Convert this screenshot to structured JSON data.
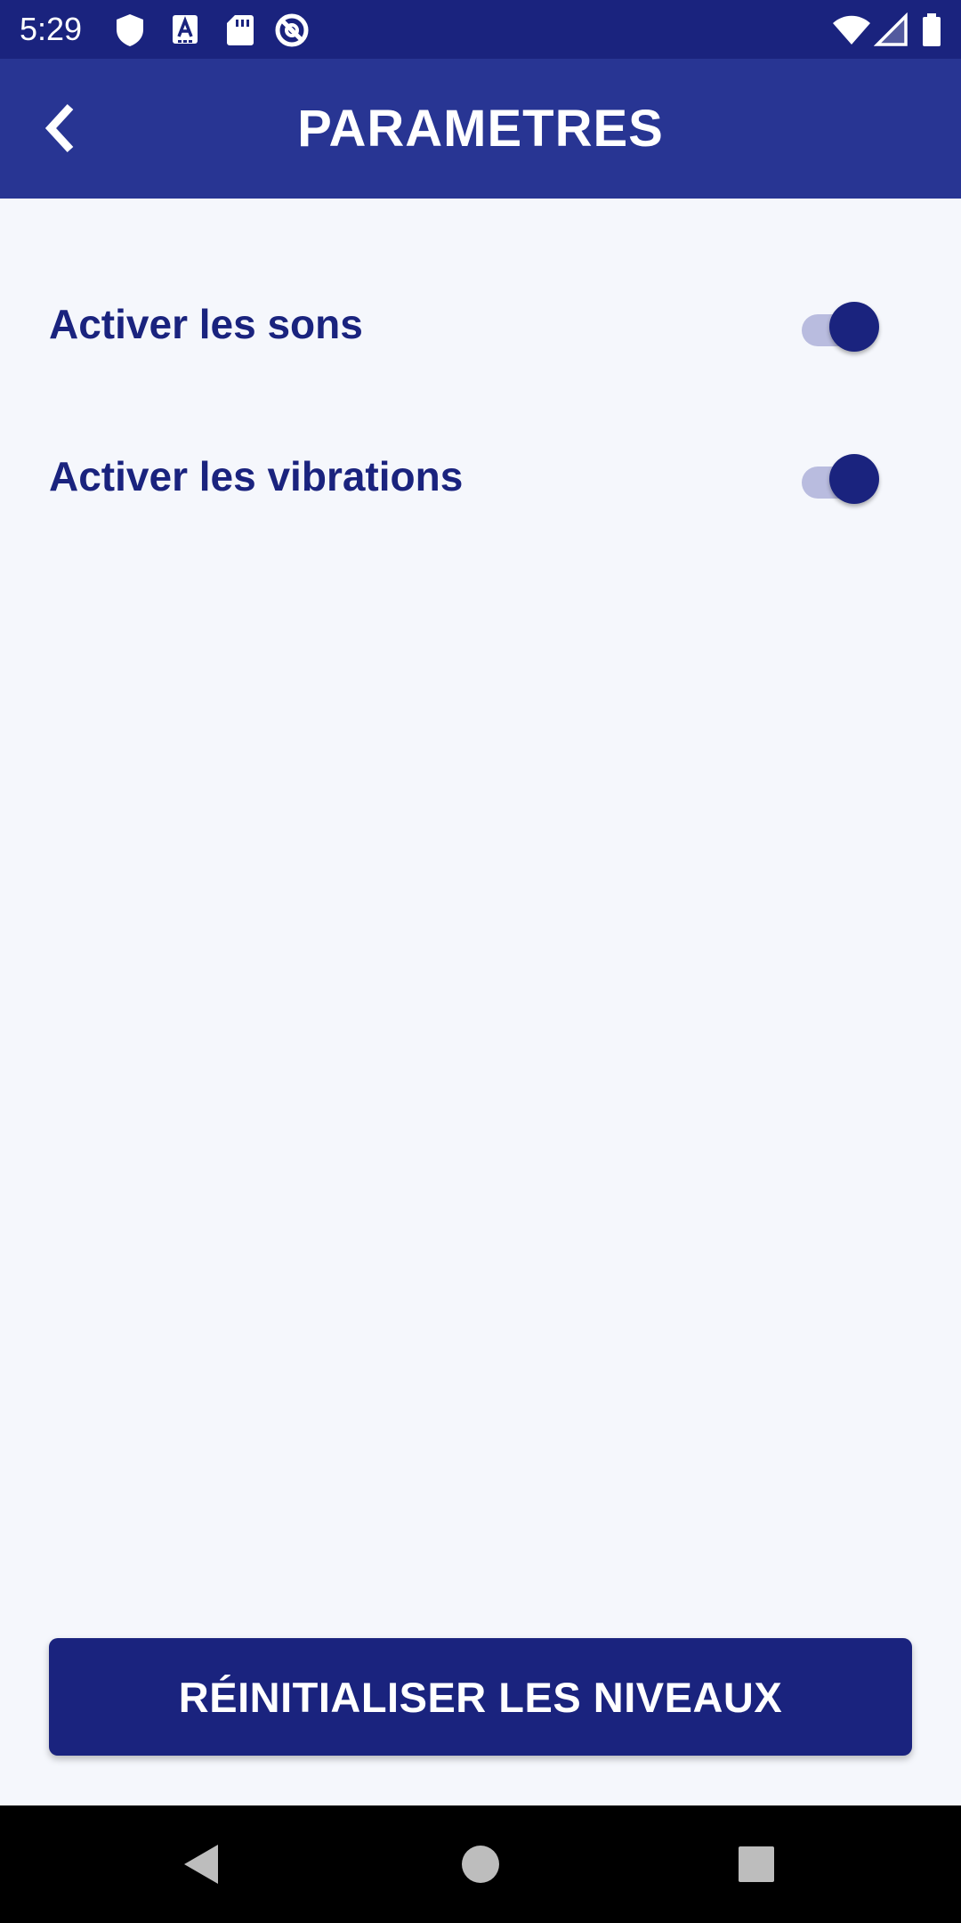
{
  "status_bar": {
    "time": "5:29",
    "left_icons": [
      "shield-icon",
      "font-a-icon",
      "sd-card-icon",
      "no-tracking-icon"
    ],
    "right_icons": [
      "wifi-icon",
      "signal-icon",
      "battery-icon"
    ]
  },
  "app_bar": {
    "title": "PARAMETRES",
    "back_icon": "chevron-left-icon"
  },
  "settings": [
    {
      "label": "Activer les sons",
      "enabled": true
    },
    {
      "label": "Activer les vibrations",
      "enabled": true
    }
  ],
  "actions": {
    "reset_label": "RÉINITIALISER LES NIVEAUX"
  },
  "nav_bar": {
    "buttons": [
      "back-triangle-icon",
      "home-circle-icon",
      "recents-square-icon"
    ]
  },
  "colors": {
    "primary_dark": "#1A237E",
    "primary": "#283593",
    "background": "#F5F7FC",
    "switch_track": "#B9BCDF"
  }
}
